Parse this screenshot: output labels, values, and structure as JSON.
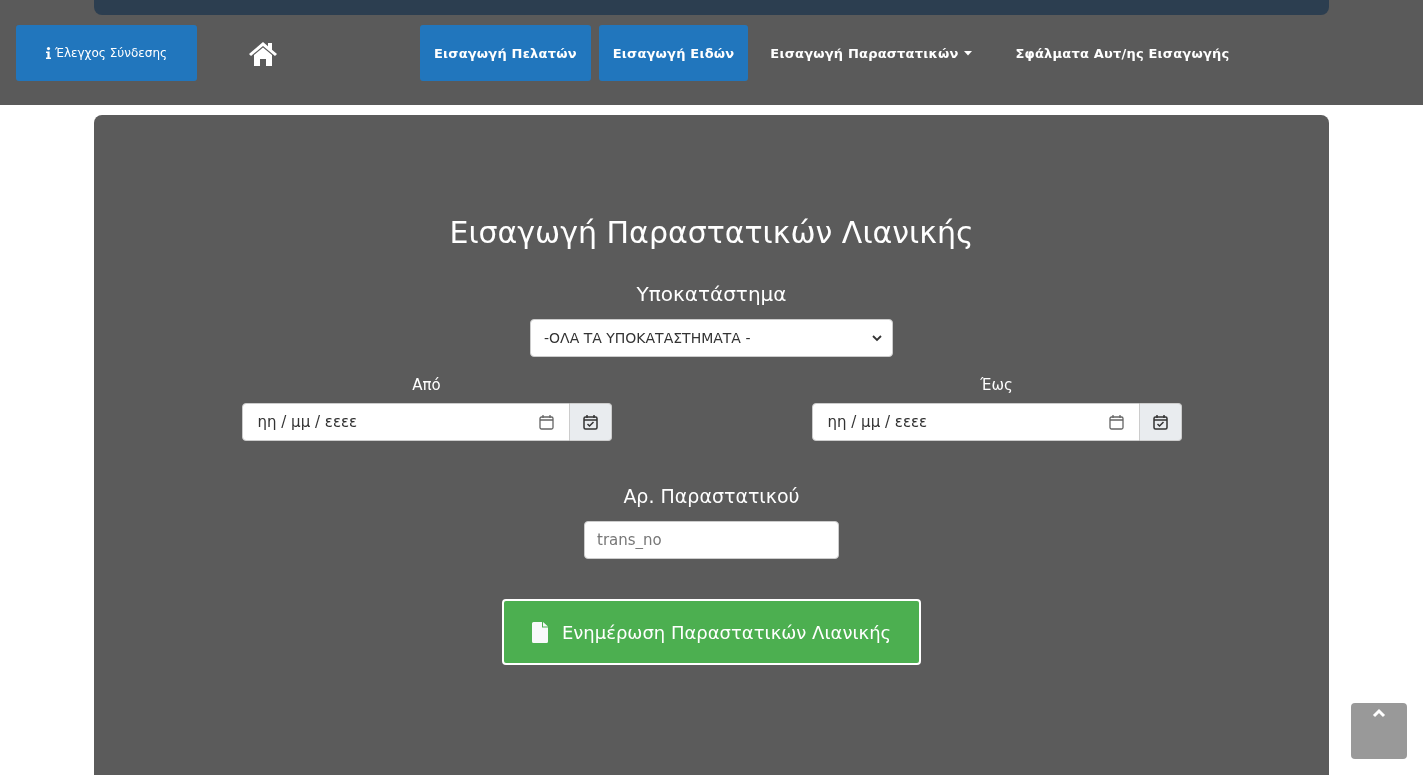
{
  "navbar": {
    "connection_button": "Έλεγχος Σύνδεσης",
    "items": [
      {
        "label": "Εισαγωγή Πελατών",
        "kind": "button"
      },
      {
        "label": "Εισαγωγή Ειδών",
        "kind": "button"
      },
      {
        "label": "Εισαγωγή Παραστατικών",
        "kind": "dropdown"
      },
      {
        "label": "Σφάλματα Αυτ/ης Εισαγωγής",
        "kind": "link"
      }
    ]
  },
  "form": {
    "title": "Εισαγωγή Παραστατικών Λιανικής",
    "branch_label": "Υποκατάστημα",
    "branch_value": "-ΟΛΑ ΤΑ ΥΠΟΚΑΤΑΣΤΗΜΑΤΑ -",
    "date_fields": [
      {
        "label": "Από",
        "placeholder": "ηη / μμ / εεεε"
      },
      {
        "label": "Έως",
        "placeholder": "ηη / μμ / εεεε"
      }
    ],
    "number_label": "Αρ. Παραστατικού",
    "number_placeholder": "trans_no",
    "submit_button": "Ενημέρωση Παραστατικών Λιανικής"
  }
}
